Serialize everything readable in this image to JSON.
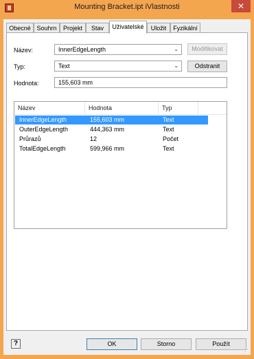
{
  "window": {
    "title": "Mounting Bracket.ipt iVlastnosti",
    "close_glyph": "✕"
  },
  "tabs": [
    {
      "label": "Obecné"
    },
    {
      "label": "Souhrn"
    },
    {
      "label": "Projekt"
    },
    {
      "label": "Stav"
    },
    {
      "label": "Uživatelské",
      "active": true
    },
    {
      "label": "Uložit"
    },
    {
      "label": "Fyzikální"
    }
  ],
  "form": {
    "name_label": "Název:",
    "name_value": "InnerEdgeLength",
    "type_label": "Typ:",
    "type_value": "Text",
    "value_label": "Hodnota:",
    "value_value": "155,603 mm",
    "modify_button": "Modifikovat",
    "remove_button": "Odstranit"
  },
  "list": {
    "columns": [
      "Název",
      "Hodnota",
      "Typ"
    ],
    "rows": [
      {
        "name": "InnerEdgeLength",
        "value": "155,603 mm",
        "type": "Text",
        "selected": true
      },
      {
        "name": "OuterEdgeLength",
        "value": "444,363 mm",
        "type": "Text"
      },
      {
        "name": "Průrazů",
        "value": "12",
        "type": "Počet"
      },
      {
        "name": "TotalEdgeLength",
        "value": "599,966 mm",
        "type": "Text"
      }
    ]
  },
  "footer": {
    "help_glyph": "?",
    "ok_button": "OK",
    "cancel_button": "Storno",
    "apply_button": "Použít"
  },
  "colors": {
    "frame": "#f4a64f",
    "selection": "#3399ff",
    "close": "#c74a3a"
  }
}
